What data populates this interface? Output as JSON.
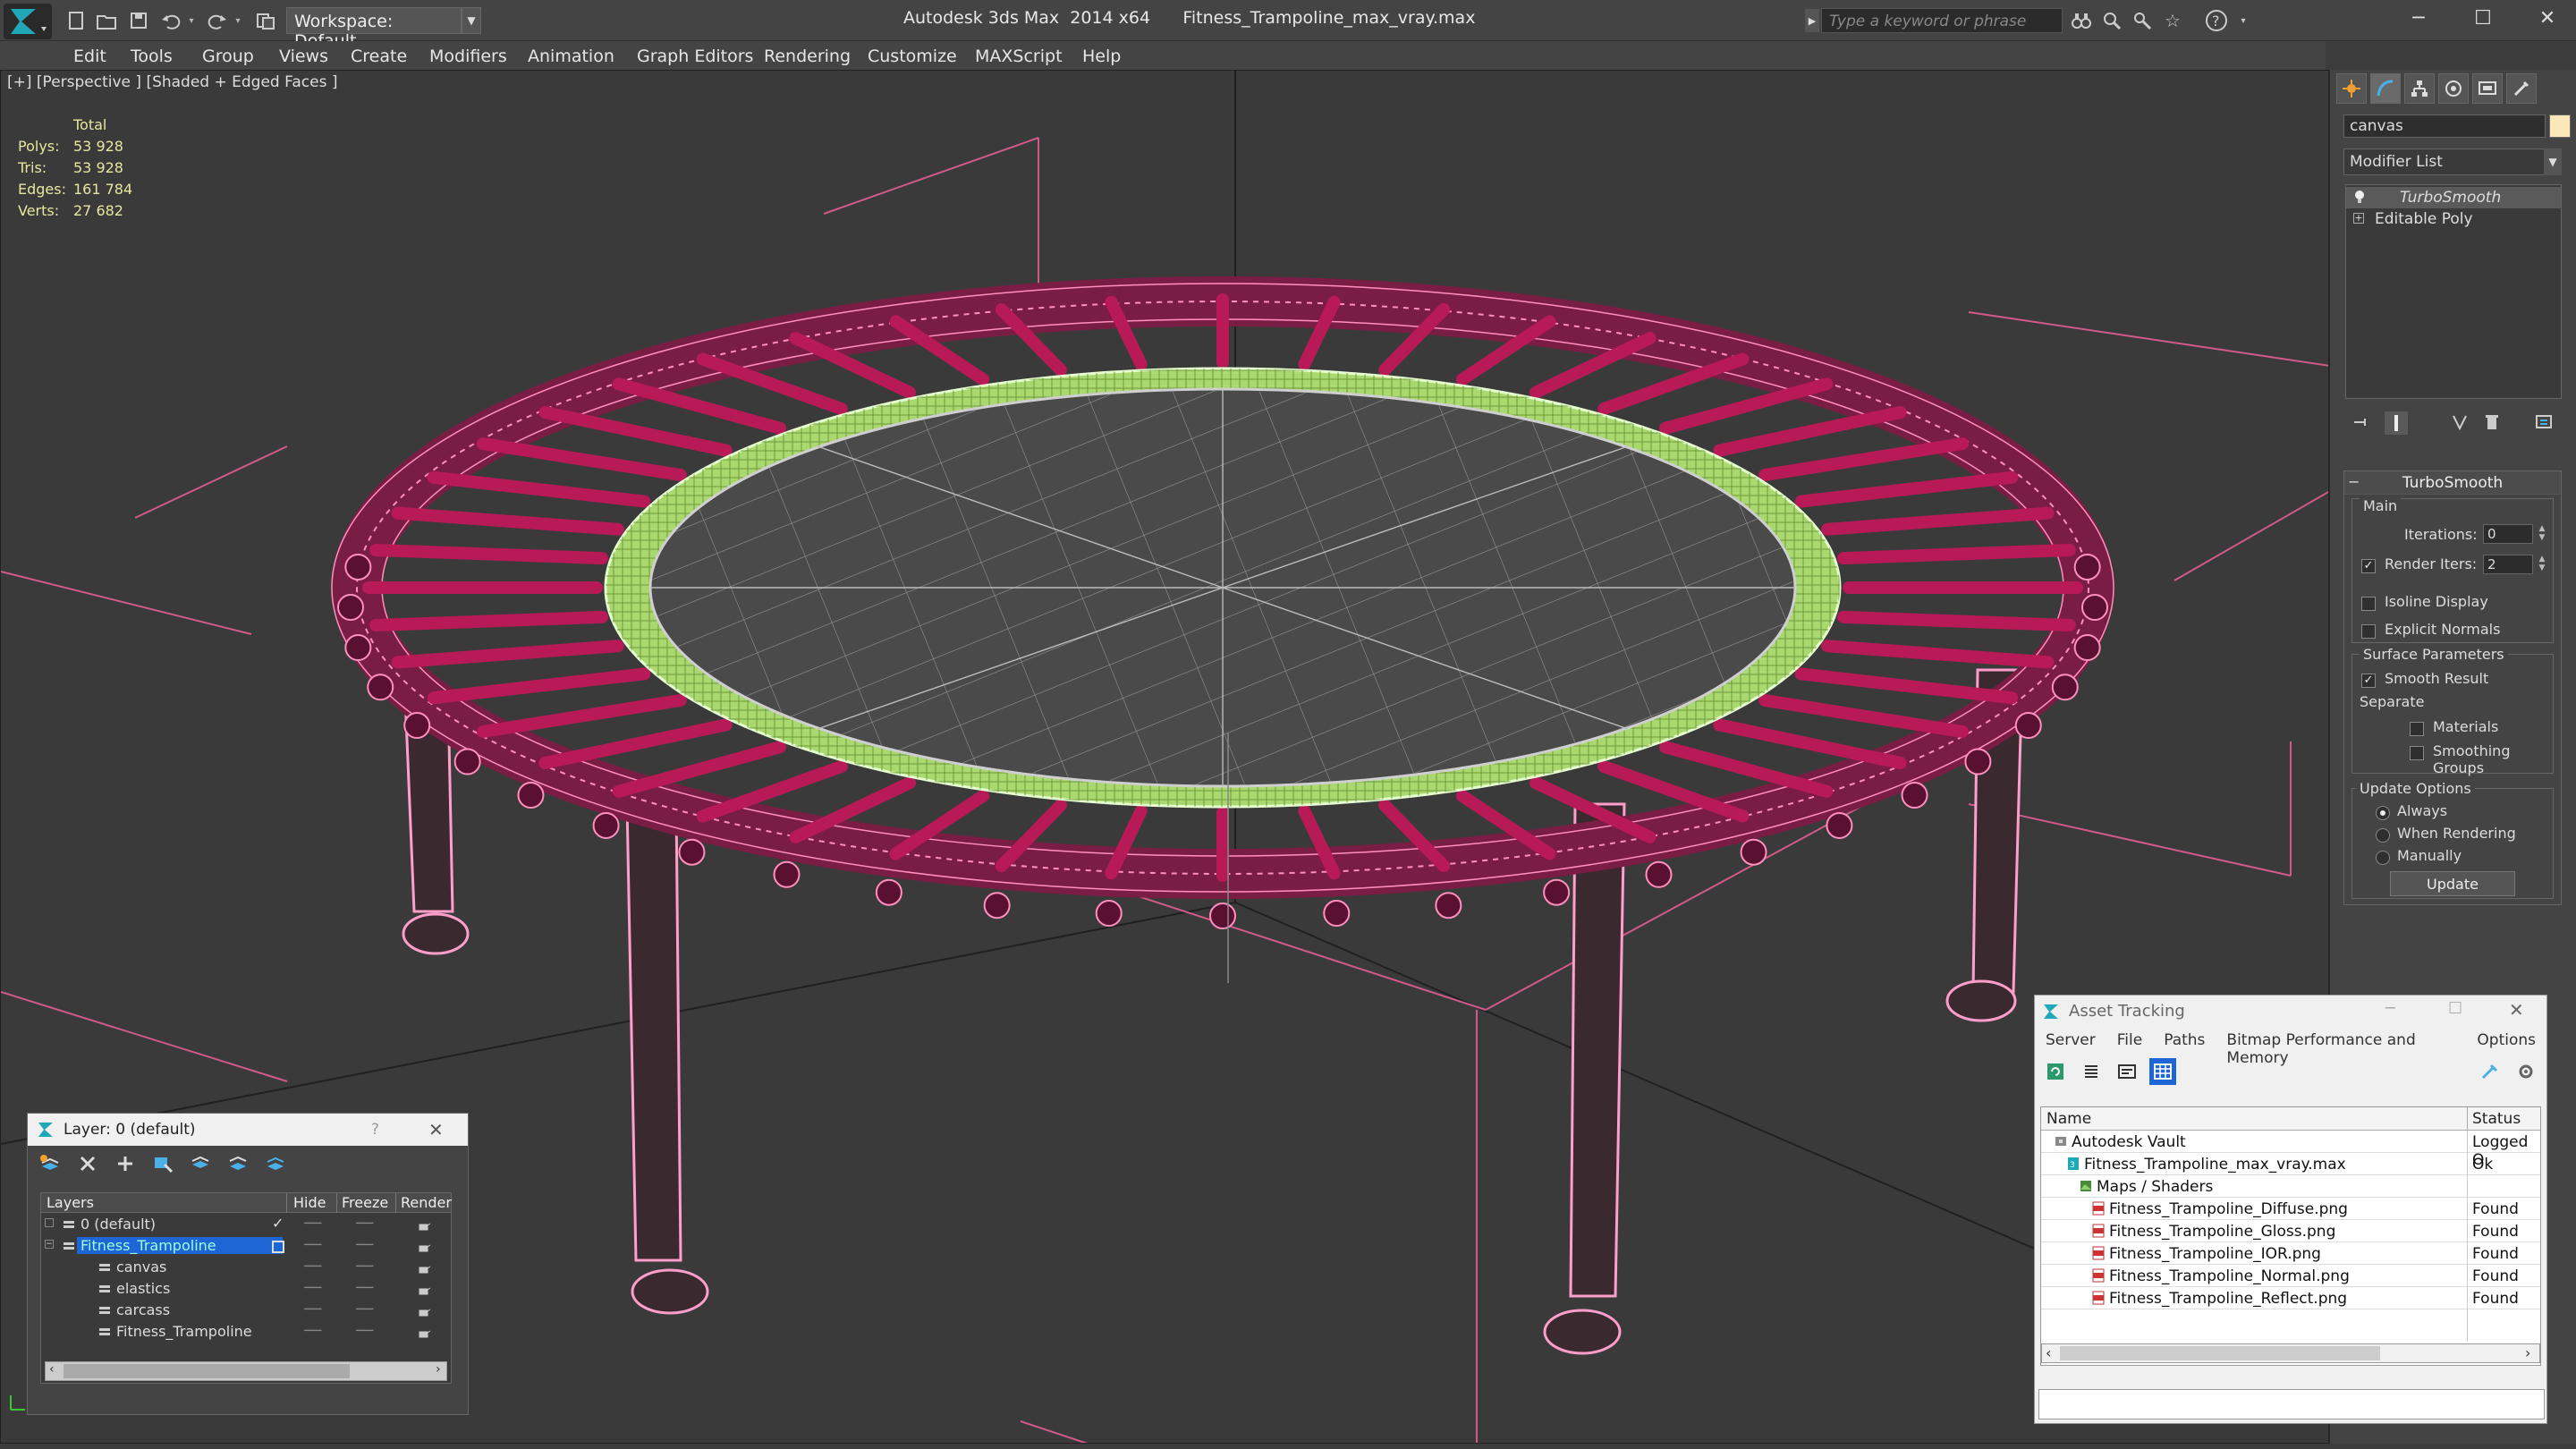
{
  "titlebar": {
    "workspace": "Workspace: Default",
    "app_title": "Autodesk 3ds Max  2014 x64",
    "file_title": "Fitness_Trampoline_max_vray.max",
    "search_placeholder": "Type a keyword or phrase"
  },
  "menu": [
    "Edit",
    "Tools",
    "Group",
    "Views",
    "Create",
    "Modifiers",
    "Animation",
    "Graph Editors",
    "Rendering",
    "Customize",
    "MAXScript",
    "Help"
  ],
  "viewport": {
    "label": "[+] [Perspective ] [Shaded + Edged Faces ]",
    "stats": {
      "header": "Total",
      "rows": [
        {
          "label": "Polys:",
          "value": "53 928"
        },
        {
          "label": "Tris:",
          "value": "53 928"
        },
        {
          "label": "Edges:",
          "value": "161 784"
        },
        {
          "label": "Verts:",
          "value": "27 682"
        }
      ]
    }
  },
  "command_panel": {
    "object_name": "canvas",
    "object_color": "#fbe7b8",
    "modifier_list": "Modifier List",
    "stack": [
      "TurboSmooth",
      "Editable Poly"
    ],
    "turbosmooth": {
      "title": "TurboSmooth",
      "main": "Main",
      "iterations_label": "Iterations:",
      "iterations_value": "0",
      "render_iters_label": "Render Iters:",
      "render_iters_value": "2",
      "render_iters_checked": true,
      "isoline": "Isoline Display",
      "explicit": "Explicit Normals",
      "surface": "Surface Parameters",
      "smooth_result": "Smooth Result",
      "separate": "Separate",
      "materials": "Materials",
      "smoothing_groups": "Smoothing Groups",
      "update_options": "Update Options",
      "always": "Always",
      "when_rendering": "When Rendering",
      "manually": "Manually",
      "update_button": "Update"
    }
  },
  "layer_dialog": {
    "title": "Layer: 0 (default)",
    "help": "?",
    "columns": [
      "Layers",
      "Hide",
      "Freeze",
      "Render"
    ],
    "rows": [
      {
        "name": "0 (default)",
        "indent": 0,
        "selected": false
      },
      {
        "name": "Fitness_Trampoline",
        "indent": 0,
        "selected": true
      },
      {
        "name": "canvas",
        "indent": 1,
        "selected": false
      },
      {
        "name": "elastics",
        "indent": 1,
        "selected": false
      },
      {
        "name": "carcass",
        "indent": 1,
        "selected": false
      },
      {
        "name": "Fitness_Trampoline",
        "indent": 1,
        "selected": false
      }
    ]
  },
  "asset_tracking": {
    "title": "Asset Tracking",
    "menu": [
      "Server",
      "File",
      "Paths",
      "Bitmap Performance and Memory",
      "Options"
    ],
    "columns": [
      "Name",
      "Status"
    ],
    "rows": [
      {
        "name": "Autodesk Vault",
        "status": "Logged O",
        "indent": 1,
        "icon": "vault-icon"
      },
      {
        "name": "Fitness_Trampoline_max_vray.max",
        "status": "Ok",
        "indent": 2,
        "icon": "max-file-icon"
      },
      {
        "name": "Maps / Shaders",
        "status": "",
        "indent": 3,
        "icon": "maps-icon"
      },
      {
        "name": "Fitness_Trampoline_Diffuse.png",
        "status": "Found",
        "indent": 4,
        "icon": "png-icon"
      },
      {
        "name": "Fitness_Trampoline_Gloss.png",
        "status": "Found",
        "indent": 4,
        "icon": "png-icon"
      },
      {
        "name": "Fitness_Trampoline_IOR.png",
        "status": "Found",
        "indent": 4,
        "icon": "png-icon"
      },
      {
        "name": "Fitness_Trampoline_Normal.png",
        "status": "Found",
        "indent": 4,
        "icon": "png-icon"
      },
      {
        "name": "Fitness_Trampoline_Reflect.png",
        "status": "Found",
        "indent": 4,
        "icon": "png-icon"
      }
    ]
  },
  "colors": {
    "frame": "#c2185b",
    "mat_ring": "#a9d86e",
    "wire": "#ff7fb0",
    "selection": "#1e66d6"
  }
}
